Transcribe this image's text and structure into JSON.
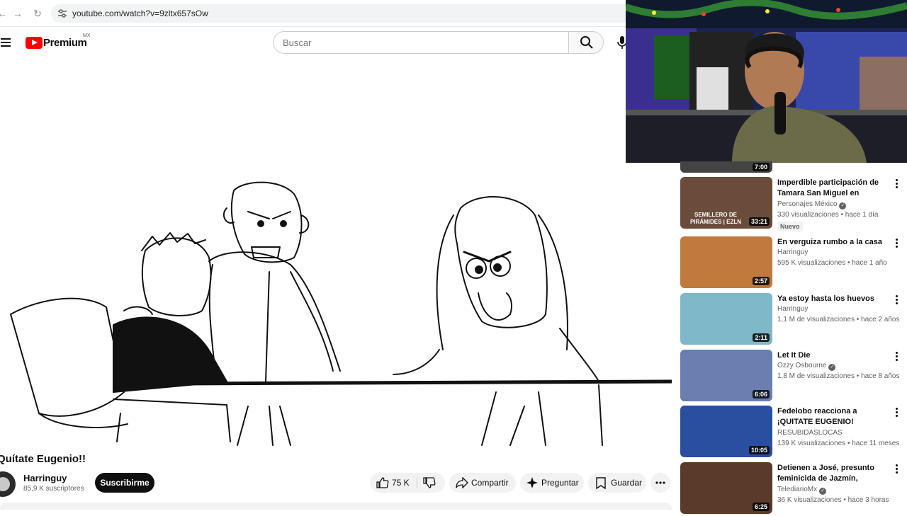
{
  "browser": {
    "url": "youtube.com/watch?v=9zltx657sOw"
  },
  "header": {
    "logo_text": "Premium",
    "region": "MX",
    "search_placeholder": "Buscar"
  },
  "video": {
    "title": "Quítate Eugenio!!",
    "channel": "Harringuy",
    "subscribers": "85,9 K suscriptores",
    "subscribe_label": "Suscribirme",
    "likes": "75 K",
    "share_label": "Compartir",
    "ask_label": "Preguntar",
    "save_label": "Guardar"
  },
  "related": {
    "top_partial_duration": "7:00",
    "items": [
      {
        "title": "Imperdible participación de Tamara San Miguel en Semille...",
        "channel": "Personajes México",
        "verified": true,
        "meta": "330 visualizaciones • hace 1 día",
        "badge": "Nuevo",
        "duration": "33:21",
        "thumb_text": "SEMILLERO DE PIRÁMIDES | EZLN",
        "thumb_color": "#6b4b3a"
      },
      {
        "title": "En verguiza rumbo a la casa",
        "channel": "Harringuy",
        "verified": false,
        "meta": "595 K visualizaciones • hace 1 año",
        "duration": "2:57",
        "thumb_color": "#c07a3e"
      },
      {
        "title": "Ya estoy hasta los huevos",
        "channel": "Harringuy",
        "verified": false,
        "meta": "1,1 M de visualizaciones • hace 2 años",
        "duration": "2:11",
        "thumb_color": "#7fb8c9"
      },
      {
        "title": "Let It Die",
        "channel": "Ozzy Osbourne",
        "verified": true,
        "meta": "1,8 M de visualizaciones • hace 8 años",
        "duration": "6:06",
        "thumb_color": "#6a7fb0"
      },
      {
        "title": "Fedelobo reacciona a ¡QUITATE EUGENIO!",
        "channel": "RESUBIDASLOCAS",
        "verified": false,
        "meta": "139 K visualizaciones • hace 11 meses",
        "duration": "10:05",
        "thumb_color": "#2a4fa0"
      },
      {
        "title": "Detienen a José, presunto feminicida de Jazmín, agente ...",
        "channel": "TelediarioMx",
        "verified": true,
        "meta": "36 K visualizaciones • hace 3 horas",
        "duration": "6:25",
        "thumb_color": "#5a3a2a"
      }
    ]
  }
}
